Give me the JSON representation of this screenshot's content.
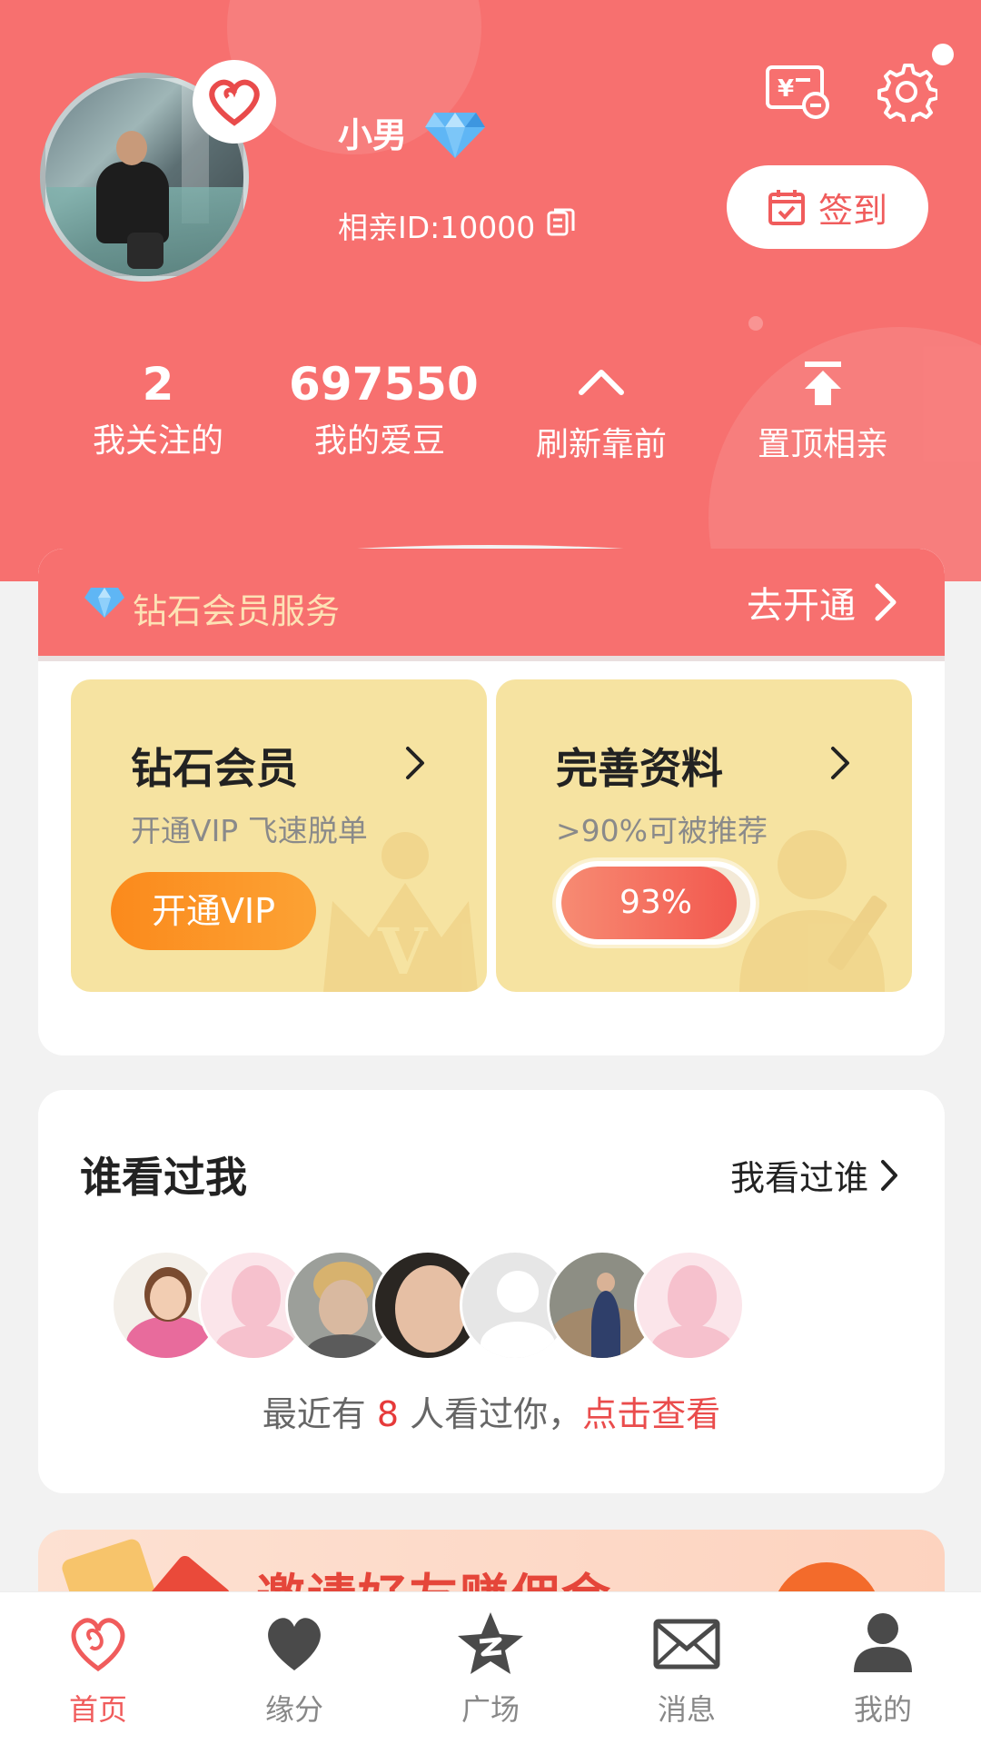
{
  "profile": {
    "name": "小男",
    "id_text": "相亲ID:10000",
    "checkin_label": "签到"
  },
  "stats": [
    {
      "value": "2",
      "label": "我关注的"
    },
    {
      "value": "697550",
      "label": "我的爱豆"
    },
    {
      "icon": "chevron-up-icon",
      "label": "刷新靠前"
    },
    {
      "icon": "pin-top-icon",
      "label": "置顶相亲"
    }
  ],
  "vip": {
    "header_title": "钻石会员服务",
    "open_link": "去开通",
    "diamond_card": {
      "title": "钻石会员",
      "subtitle": "开通VIP 飞速脱单",
      "button": "开通VIP"
    },
    "profile_card": {
      "title": "完善资料",
      "subtitle": ">90%可被推荐",
      "progress_text": "93%",
      "progress": 0.93
    }
  },
  "viewers": {
    "title": "谁看过我",
    "link": "我看过谁",
    "note_prefix": "最近有 ",
    "count": "8",
    "note_suffix": " 人看过你，",
    "action": "点击查看"
  },
  "invite": {
    "text": "邀请好友赚佣金"
  },
  "tabs": [
    {
      "label": "首页",
      "icon": "heart-logo-icon",
      "active": true
    },
    {
      "label": "缘分",
      "icon": "heart-icon",
      "active": false
    },
    {
      "label": "广场",
      "icon": "star-icon",
      "active": false
    },
    {
      "label": "消息",
      "icon": "envelope-icon",
      "active": false
    },
    {
      "label": "我的",
      "icon": "person-icon",
      "active": false
    }
  ],
  "colors": {
    "brand": "#f7706f",
    "accent_red": "#e63a3a",
    "vip_gold": "#f6e3a1",
    "vip_orange": "#fb8a1c"
  }
}
